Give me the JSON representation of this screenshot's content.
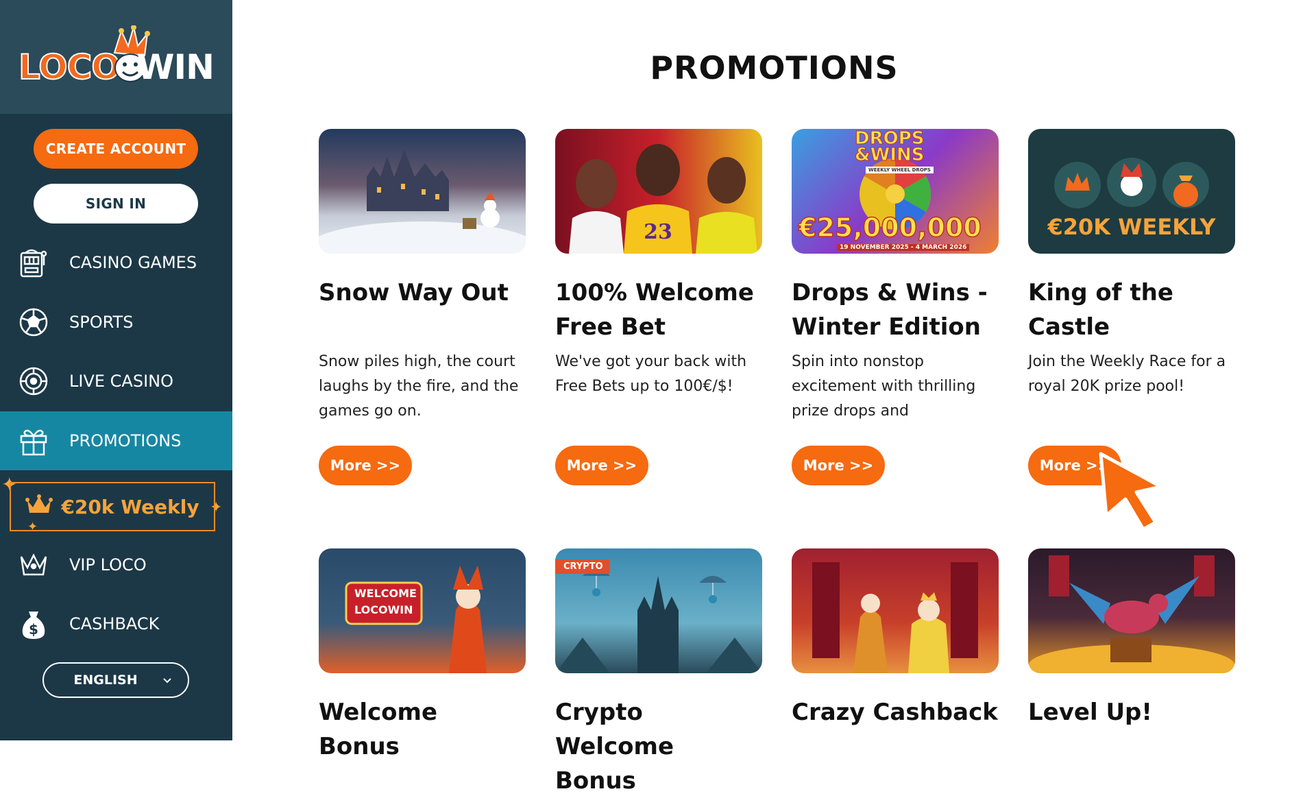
{
  "brand": {
    "logo_left": "LOCO",
    "logo_right": "WIN"
  },
  "sidebar": {
    "create_account": "CREATE ACCOUNT",
    "sign_in": "SIGN IN",
    "items": [
      {
        "label": "CASINO GAMES",
        "icon": "slot-machine-icon"
      },
      {
        "label": "SPORTS",
        "icon": "soccer-ball-icon"
      },
      {
        "label": "LIVE CASINO",
        "icon": "roulette-icon"
      },
      {
        "label": "PROMOTIONS",
        "icon": "gift-icon",
        "active": true
      },
      {
        "label": "VIP LOCO",
        "icon": "crown-icon"
      },
      {
        "label": "CASHBACK",
        "icon": "money-bag-icon"
      }
    ],
    "weekly_badge": "€20k Weekly",
    "language": "ENGLISH"
  },
  "main": {
    "title": "PROMOTIONS",
    "promotions": [
      {
        "title": "Snow Way Out",
        "description": "Snow piles high, the court laughs by the fire, and the games go on.",
        "button": "More >>"
      },
      {
        "title": "100% Welcome Free Bet",
        "description": "We've got your back with Free Bets up to 100€/$!",
        "button": "More >>"
      },
      {
        "title": "Drops & Wins - Winter Edition",
        "description": "Spin into nonstop excitement with thrilling prize drops and",
        "button": "More >>",
        "banner_line1": "DROPS",
        "banner_line2": "&WINS",
        "banner_amount": "€25,000,000",
        "banner_dates": "19 NOVEMBER 2025 - 4 MARCH 2026",
        "banner_sub": "WEEKLY WHEEL DROPS"
      },
      {
        "title": "King of the Castle",
        "description": "Join the Weekly Race for a royal 20K prize pool!",
        "button": "More >>",
        "banner_text": "€20K WEEKLY"
      },
      {
        "title": "Welcome Bonus",
        "banner_sign1": "WELCOME",
        "banner_sign2": "LOCOWIN"
      },
      {
        "title": "Crypto Welcome Bonus",
        "banner_tag": "CRYPTO"
      },
      {
        "title": "Crazy Cashback"
      },
      {
        "title": "Level Up!"
      }
    ]
  },
  "colors": {
    "sidebar_bg": "#1c3847",
    "active_bg": "#1687a2",
    "accent": "#f66a10"
  }
}
